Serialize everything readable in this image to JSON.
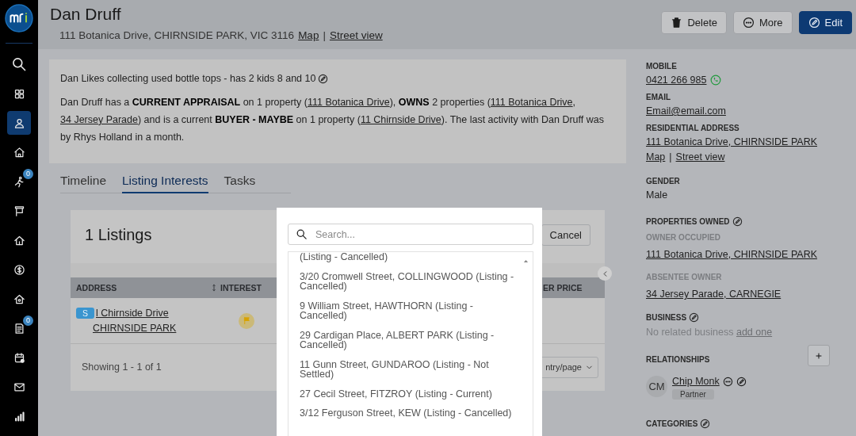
{
  "sidebar": {
    "items": [
      {
        "kind": "search",
        "selected": false
      },
      {
        "kind": "grid",
        "selected": false
      },
      {
        "kind": "person",
        "selected": true
      },
      {
        "kind": "home",
        "selected": false
      },
      {
        "kind": "runner",
        "selected": false,
        "badge": "0"
      },
      {
        "kind": "sign",
        "selected": false
      },
      {
        "kind": "house",
        "selected": false
      },
      {
        "kind": "dollar",
        "selected": false
      },
      {
        "kind": "house2",
        "selected": false
      },
      {
        "kind": "checklist",
        "selected": false,
        "badge": "0"
      },
      {
        "kind": "calendar",
        "selected": false
      },
      {
        "kind": "mail",
        "selected": false
      },
      {
        "kind": "chart",
        "selected": false
      }
    ]
  },
  "contact": {
    "name": "Dan Druff",
    "address": "111 Botanica Drive, CHIRNSIDE PARK, VIC 3116",
    "map_link": "Map",
    "separator": "|",
    "street_view_link": "Street view"
  },
  "actions": [
    {
      "label": "Delete",
      "kind": "delete",
      "primary": false
    },
    {
      "label": "More",
      "kind": "more",
      "primary": false
    },
    {
      "label": "Edit",
      "kind": "edit",
      "primary": true
    }
  ],
  "note": "Dan Likes collecting used bottle tops - has 2 kids 8 and 10",
  "summary": [
    {
      "kind": "text",
      "text": "Dan Druff has a "
    },
    {
      "kind": "bold",
      "text": "CURRENT APPRAISAL"
    },
    {
      "kind": "text",
      "text": " on 1 property ("
    },
    {
      "kind": "link",
      "text": "111 Botanica Drive"
    },
    {
      "kind": "text",
      "text": "), "
    },
    {
      "kind": "bold",
      "text": "OWNS"
    },
    {
      "kind": "text",
      "text": " 2 properties ("
    },
    {
      "kind": "link",
      "text": "111 Botanica Drive"
    },
    {
      "kind": "text",
      "text": ", "
    },
    {
      "kind": "link",
      "text": "34 Jersey Parade"
    },
    {
      "kind": "text",
      "text": ") and is a current "
    },
    {
      "kind": "bold",
      "text": "BUYER - MAYBE"
    },
    {
      "kind": "text",
      "text": " on 1 property ("
    },
    {
      "kind": "link",
      "text": "11 Chirnside Drive"
    },
    {
      "kind": "text",
      "text": "). The last activity with Dan Druff was by Rhys Holland in a month."
    }
  ],
  "tabs": [
    {
      "label": "Timeline",
      "selected": false
    },
    {
      "label": "Listing Interests",
      "selected": true
    },
    {
      "label": "Tasks",
      "selected": false
    }
  ],
  "listings": {
    "title": "1 Listings",
    "cancel": "Cancel",
    "columns": [
      "ADDRESS",
      "INTEREST"
    ],
    "column_4": "ER PRICE",
    "rows": [
      {
        "badge": "S",
        "address_line_1": "l Chirnside Drive",
        "address_line_2": "CHIRNSIDE PARK"
      }
    ],
    "footer": "Showing 1 - 1 of 1",
    "per_page": "ntry/page"
  },
  "picker": {
    "placeholder": "Search...",
    "options": [
      "(Listing - Cancelled)",
      "3/20 Cromwell Street, COLLINGWOOD (Listing - Cancelled)",
      "9 William Street, HAWTHORN (Listing - Cancelled)",
      "29 Cardigan Place, ALBERT PARK (Listing - Cancelled)",
      "11 Gunn Street, GUNDAROO (Listing - Not Settled)",
      "27 Cecil Street, FITZROY (Listing - Current)",
      "3/12 Ferguson Street, KEW (Listing - Cancelled)"
    ]
  },
  "details": {
    "mobile": {
      "label": "MOBILE",
      "value": "0421 266 985"
    },
    "email": {
      "label": "EMAIL",
      "value": "Email@email.com"
    },
    "residential": {
      "label": "RESIDENTIAL ADDRESS",
      "value": "111 Botanica Drive, CHIRNSIDE PARK",
      "map_link": "Map",
      "separator": "|",
      "street_view_link": "Street view"
    },
    "gender": {
      "label": "GENDER",
      "value": "Male"
    },
    "properties_owned": {
      "label": "PROPERTIES OWNED",
      "groups": [
        {
          "label": "OWNER OCCUPIED",
          "address": "111 Botanica Drive, CHIRNSIDE PARK"
        },
        {
          "label": "ABSENTEE OWNER",
          "address": "34 Jersey Parade, CARNEGIE"
        }
      ]
    },
    "business": {
      "label": "BUSINESS",
      "empty_text": "No related business",
      "link": "add one"
    },
    "relationships": {
      "label": "RELATIONSHIPS",
      "people": [
        {
          "initials": "CM",
          "name": "Chip Monk",
          "role": "Partner"
        }
      ]
    },
    "categories": {
      "label": "CATEGORIES"
    }
  }
}
